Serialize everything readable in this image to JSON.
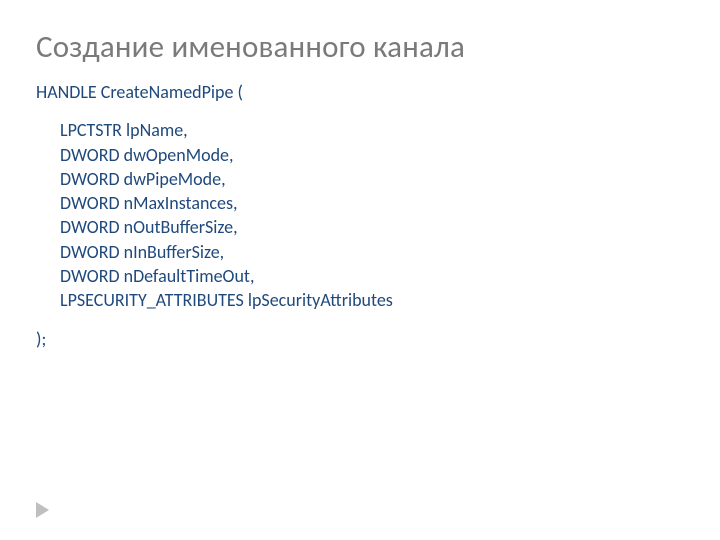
{
  "title": "Создание именованного канала",
  "func": {
    "header": "HANDLE CreateNamedPipe (",
    "params": [
      "LPCTSTR lpName,",
      "DWORD dwOpenMode,",
      "DWORD dwPipeMode,",
      "DWORD nMaxInstances,",
      "DWORD nOutBufferSize,",
      "DWORD nInBufferSize,",
      "DWORD nDefaultTimeOut,",
      "LPSECURITY_ATTRIBUTES lpSecurityAttributes"
    ],
    "close": ");"
  }
}
